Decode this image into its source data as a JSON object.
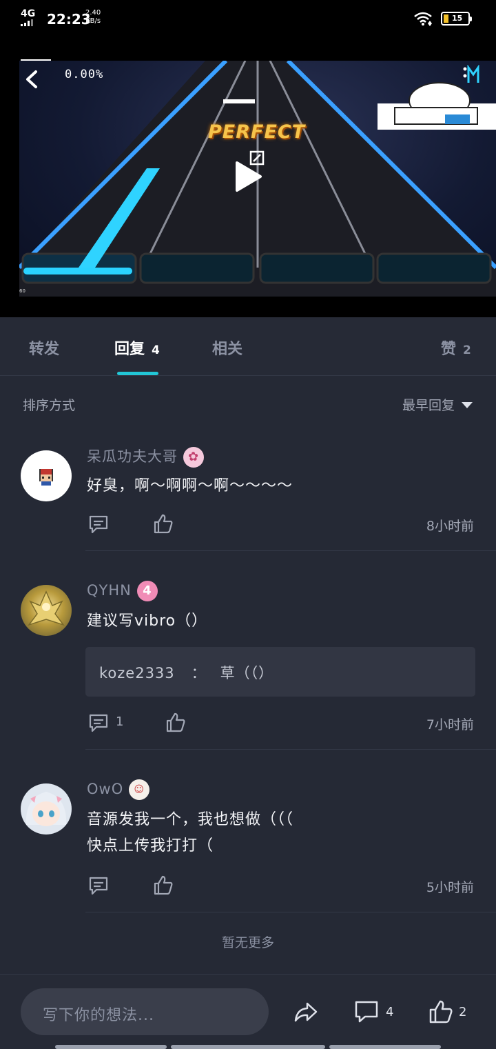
{
  "status_bar": {
    "network": "4G",
    "time": "22:23",
    "speed_value": "2.40",
    "speed_unit": "KB/s",
    "battery": "15"
  },
  "video": {
    "progress_text": "0.00%",
    "overlay_text": "PERFECT",
    "fps_text": "60"
  },
  "tabs": [
    {
      "label": "转发",
      "count": ""
    },
    {
      "label": "回复",
      "count": "4"
    },
    {
      "label": "相关",
      "count": ""
    },
    {
      "label": "赞",
      "count": "2"
    }
  ],
  "sort": {
    "label": "排序方式",
    "value": "最早回复"
  },
  "comments": [
    {
      "user": "呆瓜功夫大哥",
      "text": "好臭，啊～啊啊～啊～～～～",
      "reply_count": "",
      "time": "8小时前"
    },
    {
      "user": "QYHN",
      "badge": "4",
      "text": "建议写vibro（）",
      "reply_user": "koze2333",
      "reply_sep": "：",
      "reply_text": "草（（）",
      "reply_count": "1",
      "time": "7小时前"
    },
    {
      "user": "OwO",
      "text_line1": "音源发我一个，我也想做（（（",
      "text_line2": "快点上传我打打（",
      "reply_count": "",
      "time": "5小时前"
    }
  ],
  "no_more": "暂无更多",
  "bottom_bar": {
    "input_placeholder": "写下你的想法...",
    "comment_count": "4",
    "like_count": "2"
  },
  "colors": {
    "accent": "#22c6d6",
    "background": "#252935",
    "badge_pink": "#f08cb6"
  }
}
